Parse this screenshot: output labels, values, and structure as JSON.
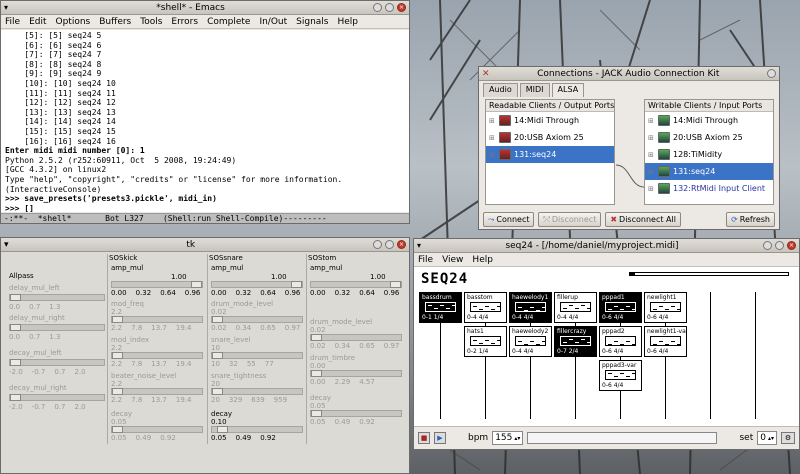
{
  "emacs": {
    "title": "*shell* - Emacs",
    "menu": [
      "File",
      "Edit",
      "Options",
      "Buffers",
      "Tools",
      "Errors",
      "Complete",
      "In/Out",
      "Signals",
      "Help"
    ],
    "lines": [
      "    [5]: [5] seq24 5",
      "    [6]: [6] seq24 6",
      "    [7]: [7] seq24 7",
      "    [8]: [8] seq24 8",
      "    [9]: [9] seq24 9",
      "    [10]: [10] seq24 10",
      "    [11]: [11] seq24 11",
      "    [12]: [12] seq24 12",
      "    [13]: [13] seq24 13",
      "    [14]: [14] seq24 14",
      "    [15]: [15] seq24 15",
      "    [16]: [16] seq24 16",
      "Enter midi midi number [0]: 1",
      "Python 2.5.2 (r252:60911, Oct  5 2008, 19:24:49)",
      "[GCC 4.3.2] on linux2",
      "Type \"help\", \"copyright\", \"credits\" or \"license\" for more information.",
      "(InteractiveConsole)",
      ">>> save_presets('presets3.pickle', midi_in)",
      ">>> []"
    ],
    "modeline": "-:**-  *shell*       Bot L327    (Shell:run Shell-Compile)---------"
  },
  "jack": {
    "title": "Connections - JACK Audio Connection Kit",
    "tabs": [
      "Audio",
      "MIDI",
      "ALSA"
    ],
    "readable_header": "Readable Clients / Output Ports",
    "writable_header": "Writable Clients / Input Ports",
    "readable": [
      "14:Midi Through",
      "20:USB Axiom 25",
      "131:seq24"
    ],
    "writable": [
      "14:Midi Through",
      "20:USB Axiom 25",
      "128:TiMidity",
      "131:seq24",
      "132:RtMidi Input Client"
    ],
    "buttons": {
      "connect": "Connect",
      "disconnect": "Disconnect",
      "disconnect_all": "Disconnect All",
      "refresh": "Refresh"
    }
  },
  "tk": {
    "title": "tk",
    "allpass": {
      "title": "Allpass",
      "params": [
        {
          "name": "delay_mul_left",
          "ticks": [
            "0.0",
            "0.7",
            "1.3"
          ]
        },
        {
          "name": "delay_mul_right",
          "ticks": [
            "0.0",
            "0.7",
            "1.3"
          ]
        },
        {
          "name": "decay_mul_left",
          "ticks": [
            "-2.0",
            "-0.7",
            "0.7",
            "2.0"
          ]
        },
        {
          "name": "decay_mul_right",
          "ticks": [
            "-2.0",
            "-0.7",
            "0.7",
            "2.0"
          ]
        }
      ]
    },
    "soskick": {
      "title": "SOSkick",
      "amp_mul": {
        "name": "amp_mul",
        "value": "1.00",
        "ticks": [
          "0.00",
          "0.32",
          "0.64",
          "0.96"
        ]
      },
      "params": [
        {
          "name": "mod_freq",
          "value": "2.2",
          "ticks": [
            "2.2",
            "7.8",
            "13.7",
            "19.4"
          ]
        },
        {
          "name": "mod_index",
          "value": "2.2",
          "ticks": [
            "2.2",
            "7.8",
            "13.7",
            "19.4"
          ]
        },
        {
          "name": "beater_noise_level",
          "value": "2.2",
          "ticks": [
            "2.2",
            "7.8",
            "13.7",
            "19.4"
          ]
        }
      ],
      "decay": {
        "name": "decay",
        "value": "0.05",
        "ticks": [
          "0.05",
          "0.49",
          "0.92"
        ]
      }
    },
    "sossnare": {
      "title": "SOSsnare",
      "amp_mul": {
        "name": "amp_mul",
        "value": "1.00",
        "ticks": [
          "0.00",
          "0.32",
          "0.64",
          "0.96"
        ]
      },
      "params": [
        {
          "name": "drum_mode_level",
          "value": "0.02",
          "ticks": [
            "0.02",
            "0.34",
            "0.65",
            "0.97"
          ]
        },
        {
          "name": "snare_level",
          "value": "10",
          "ticks": [
            "10",
            "32",
            "55",
            "77"
          ]
        },
        {
          "name": "snare_tightness",
          "value": "20",
          "ticks": [
            "20",
            "329",
            "639",
            "959"
          ]
        }
      ],
      "decay": {
        "name": "decay",
        "value": "0.10",
        "ticks": [
          "0.05",
          "0.49",
          "0.92"
        ]
      }
    },
    "sostom": {
      "title": "SOStom",
      "amp_mul": {
        "name": "amp_mul",
        "value": "1.00",
        "ticks": [
          "0.00",
          "0.32",
          "0.64",
          "0.96"
        ]
      },
      "params": [
        {
          "name": "drum_mode_level",
          "value": "0.02",
          "ticks": [
            "0.02",
            "0.34",
            "0.65",
            "0.97"
          ]
        },
        {
          "name": "drum_timbre",
          "value": "0.00",
          "ticks": [
            "0.00",
            "2.29",
            "4.57"
          ]
        }
      ],
      "decay": {
        "name": "decay",
        "value": "0.05",
        "ticks": [
          "0.05",
          "0.49",
          "0.92"
        ]
      }
    }
  },
  "seq24": {
    "title": "seq24 - [/home/daniel/myproject.midi]",
    "menu": [
      "File",
      "View",
      "Help"
    ],
    "logo": "SEQ24",
    "transport_progress": 0.03,
    "cells": [
      {
        "name": "bassdrum",
        "foot": "0-1 1/4",
        "dark": true,
        "col": 0,
        "row": 0
      },
      {
        "name": "basstom",
        "foot": "0-4 4/4",
        "dark": false,
        "col": 1,
        "row": 0
      },
      {
        "name": "haewelody1",
        "foot": "0-4 4/4",
        "dark": true,
        "col": 2,
        "row": 0
      },
      {
        "name": "fillerup",
        "foot": "0-4 4/4",
        "dark": false,
        "col": 3,
        "row": 0
      },
      {
        "name": "pppad1",
        "foot": "0-6 4/4",
        "dark": true,
        "col": 4,
        "row": 0
      },
      {
        "name": "pppad2",
        "foot": "0-6 4/4",
        "dark": false,
        "col": 4,
        "row": 1
      },
      {
        "name": "pppad3-var",
        "foot": "0-6 4/4",
        "dark": false,
        "col": 4,
        "row": 2
      },
      {
        "name": "hats1",
        "foot": "0-2 1/4",
        "dark": false,
        "col": 1,
        "row": 1
      },
      {
        "name": "haewelody2",
        "foot": "0-4 4/4",
        "dark": false,
        "col": 2,
        "row": 1
      },
      {
        "name": "fillercrazy",
        "foot": "0-7 2/4",
        "dark": true,
        "col": 3,
        "row": 1
      },
      {
        "name": "newlight1",
        "foot": "0-6 4/4",
        "dark": false,
        "col": 5,
        "row": 0
      },
      {
        "name": "newlight1-var",
        "foot": "0-6 4/4",
        "dark": false,
        "col": 5,
        "row": 1
      }
    ],
    "bpm_label": "bpm",
    "bpm": "155",
    "set_label": "set",
    "set_value": "0"
  }
}
